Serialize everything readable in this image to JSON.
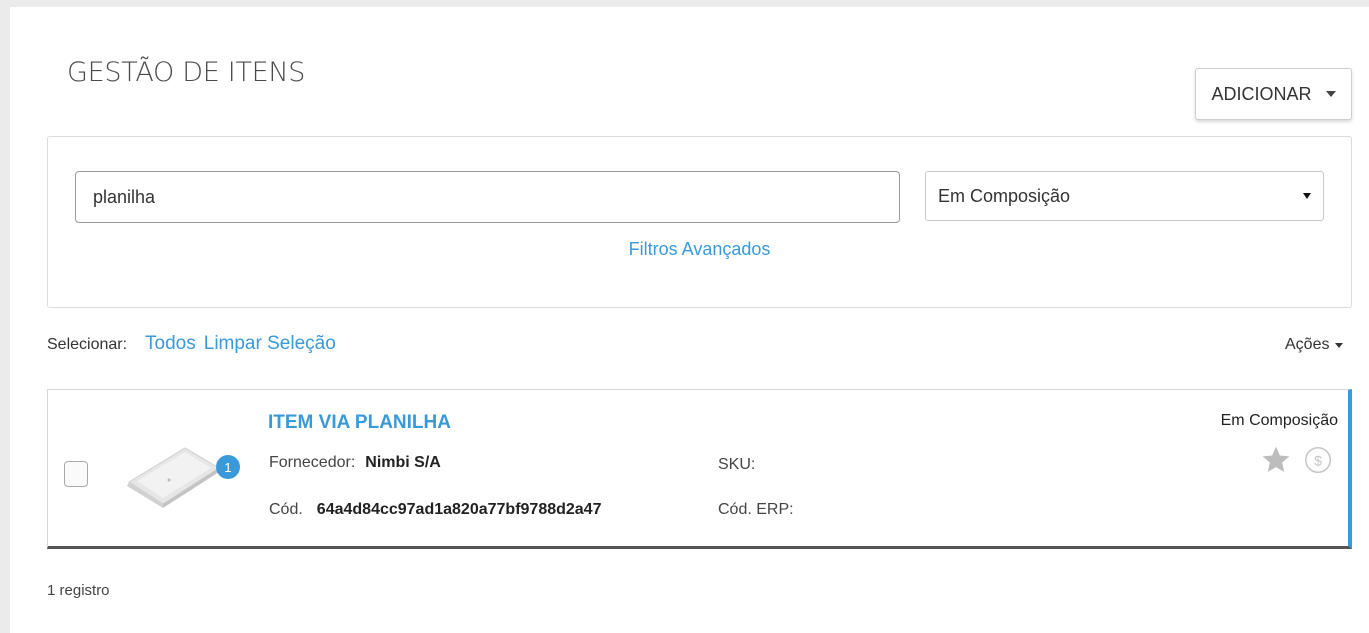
{
  "header": {
    "title": "GESTÃO DE ITENS",
    "add_button": "ADICIONAR"
  },
  "filters": {
    "search_value": "planilha",
    "status_selected": "Em Composição",
    "advanced_link": "Filtros Avançados"
  },
  "selection": {
    "label": "Selecionar:",
    "all": "Todos",
    "clear": "Limpar Seleção",
    "actions": "Ações"
  },
  "items": [
    {
      "title": "ITEM VIA PLANILHA",
      "badge": "1",
      "supplier_label": "Fornecedor:",
      "supplier_value": "Nimbi S/A",
      "code_label": "Cód.",
      "code_value": "64a4d84cc97ad1a820a77bf9788d2a47",
      "sku_label": "SKU:",
      "erp_label": "Cód. ERP:",
      "status": "Em Composição",
      "icons": [
        "star-icon",
        "dollar-icon"
      ]
    }
  ],
  "footer": {
    "count": "1 registro"
  },
  "colors": {
    "accent": "#3a9ad9",
    "background": "#ebebeb"
  }
}
